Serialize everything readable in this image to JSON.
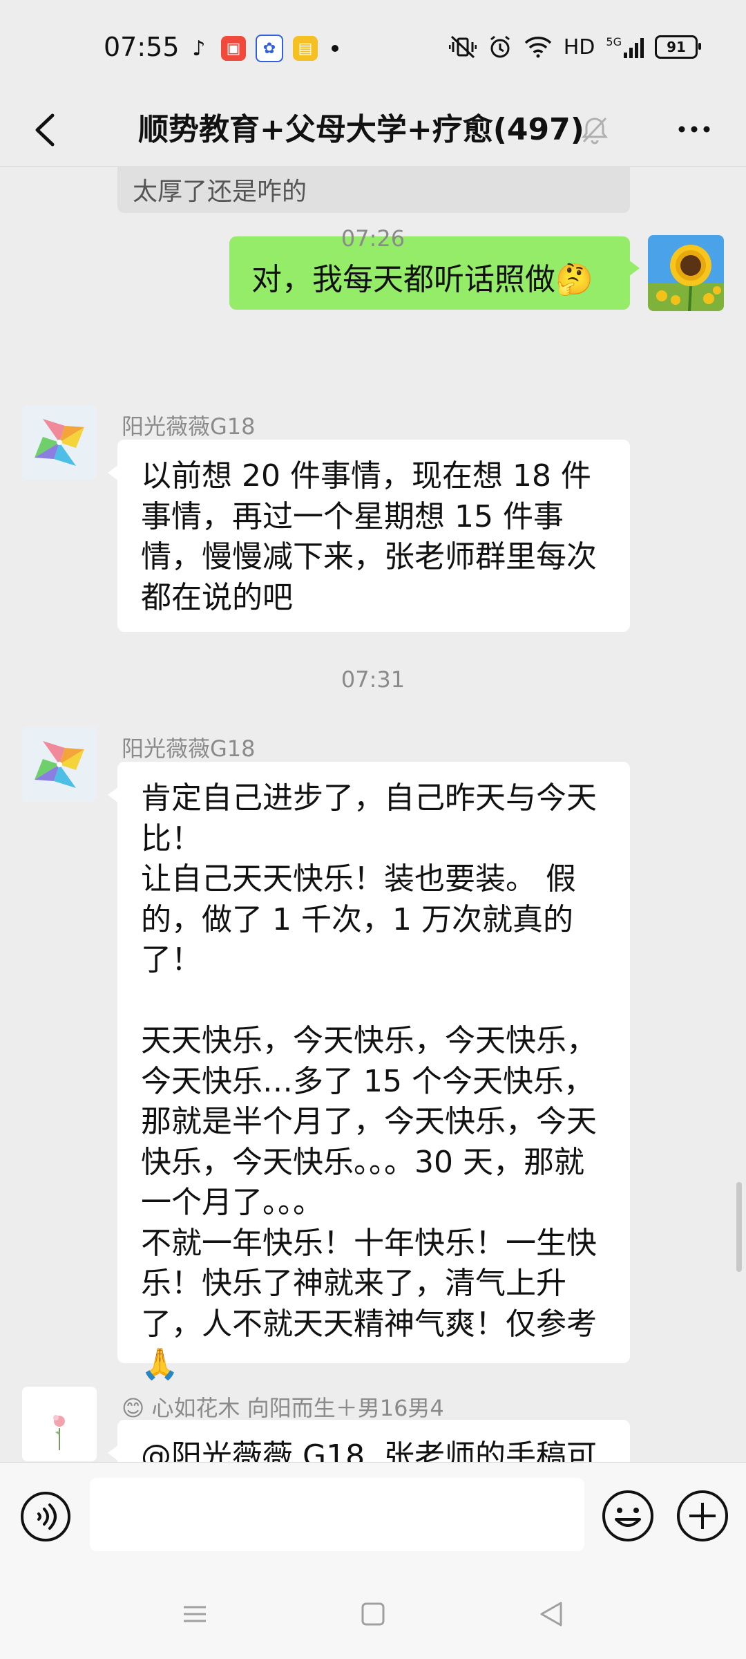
{
  "status_bar": {
    "time": "07:55",
    "app_icons": [
      "tiktok-icon",
      "kuaishou-icon",
      "baidu-icon",
      "notes-icon"
    ],
    "network": "HD",
    "signal": "5G",
    "battery": "91"
  },
  "header": {
    "title": "顺势教育+父母大学+疗愈(497)",
    "back_icon": "back-chevron-icon",
    "mute_icon": "bell-muted-icon",
    "more_icon": "more-dots-icon"
  },
  "chat": {
    "quoted_message": "太厚了还是咋的",
    "my_message": "对，我每天都听话照做🤔",
    "timestamps": [
      "07:26",
      "07:31"
    ],
    "messages": [
      {
        "sender": "阳光薇薇G18",
        "text": "以前想 20 件事情，现在想 18 件事情，再过一个星期想 15 件事情，慢慢减下来，张老师群里每次都在说的吧"
      },
      {
        "sender": "阳光薇薇G18",
        "text": "肯定自己进步了，自己昨天与今天比！\n让自己天天快乐！装也要装。 假的，做了 1 千次，1 万次就真的了！\n\n天天快乐，今天快乐，今天快乐，今天快乐…多了 15 个今天快乐，那就是半个月了，今天快乐，今天快乐，今天快乐。。。30 天，那就一个月了。。。\n不就一年快乐！十年快乐！一生快乐！快乐了神就来了，清气上升了，人不就天天精神气爽！仅参考🙏"
      },
      {
        "sender": "😊 心如花木 向阳而生＋男16男4",
        "text": "@阳光薇薇 G18  张老师的手稿可"
      }
    ]
  },
  "input_bar": {
    "voice_icon": "voice-icon",
    "input_value": "",
    "emoji_icon": "emoji-icon",
    "plus_icon": "plus-icon"
  },
  "nav_bar": {
    "icons": [
      "menu-icon",
      "home-icon",
      "back-icon"
    ]
  }
}
